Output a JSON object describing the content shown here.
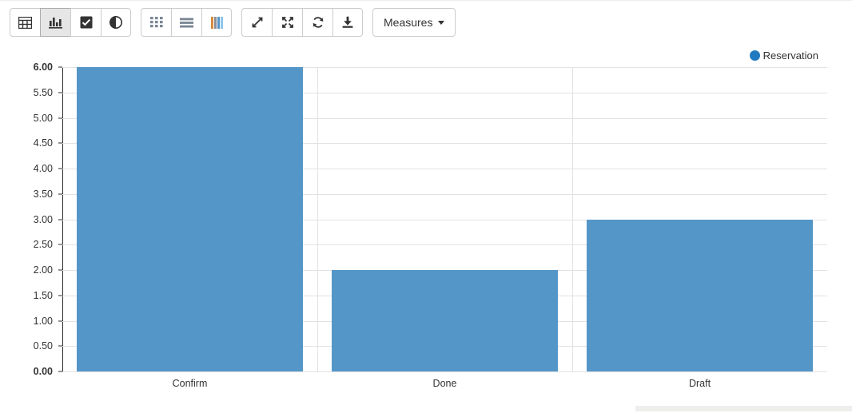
{
  "toolbar": {
    "groups": [
      {
        "name": "view-mode-group",
        "buttons": [
          {
            "icon": "table-grid-icon",
            "label": "Table view",
            "active": false
          },
          {
            "icon": "bar-chart-icon",
            "label": "Bar chart view",
            "active": true
          },
          {
            "icon": "checkbox-icon",
            "label": "Select",
            "active": false
          },
          {
            "icon": "contrast-half-circle-icon",
            "label": "Contrast",
            "active": false
          }
        ]
      },
      {
        "name": "chart-type-group",
        "buttons": [
          {
            "icon": "dots-grid-icon",
            "label": "Scatter",
            "active": false
          },
          {
            "icon": "horizontal-bars-icon",
            "label": "Horizontal bars",
            "active": false
          },
          {
            "icon": "vertical-columns-icon",
            "label": "Vertical columns",
            "active": false
          }
        ]
      },
      {
        "name": "actions-group",
        "buttons": [
          {
            "icon": "expand-diagonal-icon",
            "label": "Expand",
            "active": false
          },
          {
            "icon": "fullscreen-icon",
            "label": "Fullscreen",
            "active": false
          },
          {
            "icon": "refresh-icon",
            "label": "Refresh",
            "active": false
          },
          {
            "icon": "download-icon",
            "label": "Download",
            "active": false
          }
        ]
      }
    ],
    "measures_label": "Measures"
  },
  "chart_data": {
    "type": "bar",
    "title": "",
    "xlabel": "",
    "ylabel": "",
    "categories": [
      "Confirm",
      "Done",
      "Draft"
    ],
    "series": [
      {
        "name": "Reservation",
        "values": [
          6,
          2,
          3
        ],
        "color": "#5596c8"
      }
    ],
    "ylim": [
      0,
      6
    ],
    "yticks": [
      "0.00",
      "0.50",
      "1.00",
      "1.50",
      "2.00",
      "2.50",
      "3.00",
      "3.50",
      "4.00",
      "4.50",
      "5.00",
      "5.50",
      "6.00"
    ],
    "ytick_values": [
      0,
      0.5,
      1,
      1.5,
      2,
      2.5,
      3,
      3.5,
      4,
      4.5,
      5,
      5.5,
      6
    ],
    "grid": true,
    "legend": {
      "position": "top-right",
      "entries": [
        "Reservation"
      ]
    }
  },
  "colors": {
    "bar": "#5596c8",
    "legend_dot": "#1f7ac0",
    "grid": "#e2e2e2",
    "axis": "#2b2b2b"
  }
}
